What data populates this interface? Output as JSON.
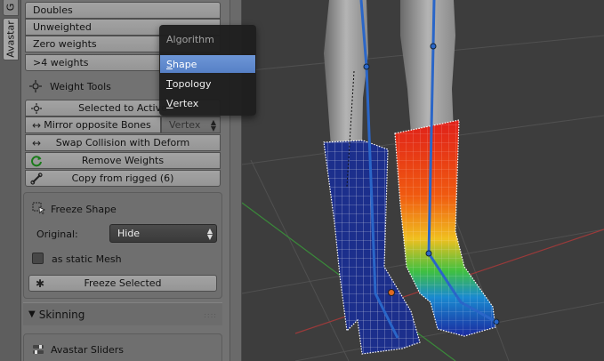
{
  "tabs": [
    {
      "label": "G",
      "active": false
    },
    {
      "label": "Avastar",
      "active": true
    }
  ],
  "weight_list": {
    "doubles": "Doubles",
    "unweighted": "Unweighted",
    "zero_weights": "Zero weights",
    "gt4_weights": ">4 weights"
  },
  "weight_tools": {
    "header": "Weight Tools",
    "selected_to_active": "Selected to Active",
    "mirror_opposite": "Mirror opposite Bones",
    "mirror_mode": "Vertex",
    "swap_collision": "Swap Collision with Deform",
    "remove_weights": "Remove Weights",
    "copy_from_rigged": "Copy from rigged (6)"
  },
  "freeze": {
    "header": "Freeze Shape",
    "original_label": "Original:",
    "original_value": "Hide",
    "static_mesh_label": "as static Mesh",
    "static_mesh_checked": false,
    "freeze_button": "Freeze Selected"
  },
  "skinning": {
    "header": "Skinning",
    "collapsed_marker": "▼",
    "avastar_sliders": "Avastar Sliders"
  },
  "algorithm_menu": {
    "title": "Algorithm",
    "items": [
      {
        "label": "Shape",
        "hotkey": "S",
        "rest": "hape",
        "selected": true
      },
      {
        "label": "Topology",
        "hotkey": "T",
        "rest": "opology",
        "selected": false
      },
      {
        "label": "Vertex",
        "hotkey": "V",
        "rest": "ertex",
        "selected": false
      }
    ]
  },
  "colors": {
    "panel_bg": "#727272",
    "viewport_bg": "#3d3d3d",
    "selection_blue": "#5b86cc",
    "boot_left": "#1c2f8c",
    "bone_blue": "#2a66c8"
  }
}
